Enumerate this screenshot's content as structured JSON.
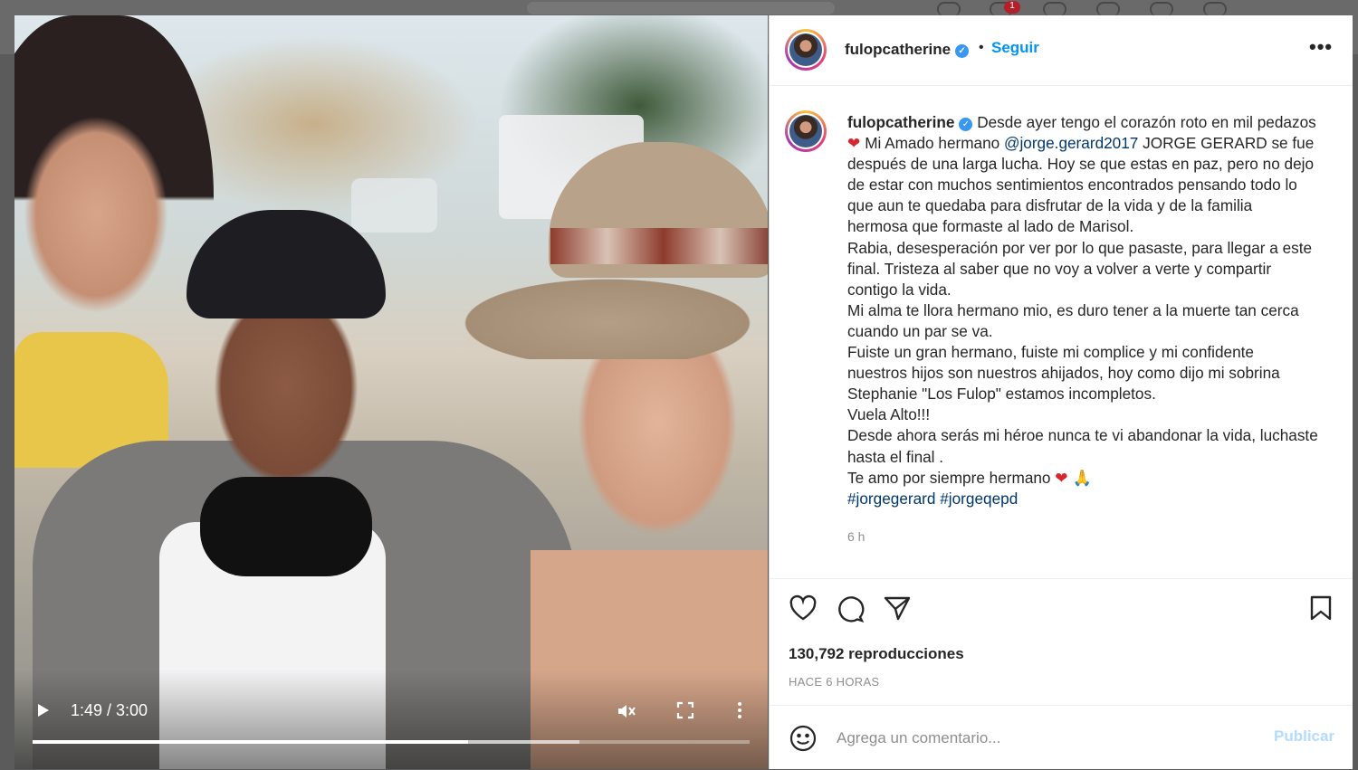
{
  "post": {
    "username": "fulopcatherine",
    "verified": true,
    "follow_label": "Seguir",
    "more_label": "•••",
    "caption_lines": [
      "Desde ayer tengo el corazón roto en mil pedazos",
      "Mi Amado hermano",
      "@jorge.gerard2017",
      "JORGE GERARD se fue",
      "después de una larga lucha. Hoy se que estas en paz, pero no dejo",
      "de estar con muchos sentimientos encontrados pensando todo lo",
      "que aun te quedaba para disfrutar de la vida y de la familia",
      "hermosa que formaste al lado de Marisol.",
      "Rabia, desesperación por ver por lo que pasaste, para llegar a este",
      "final. Tristeza al saber que no voy a volver a verte y compartir",
      "contigo la vida.",
      "Mi alma te llora hermano mio, es duro tener a la muerte tan cerca",
      "cuando un par se va.",
      "Fuiste un gran hermano, fuiste mi complice y mi confidente",
      "nuestros hijos son nuestros ahijados, hoy como dijo mi sobrina",
      "Stephanie \"Los Fulop\" estamos incompletos.",
      "Vuela Alto!!!",
      "Desde ahora serás mi héroe nunca te vi abandonar la vida, luchaste",
      "hasta el final .",
      "Te amo por siempre hermano",
      "#jorgegerard",
      "#jorgeqepd"
    ],
    "caption_age": "6 h",
    "views": "130,792 reproducciones",
    "posted": "HACE 6 HORAS",
    "comment_placeholder": "Agrega un comentario...",
    "publish_label": "Publicar"
  },
  "video": {
    "time": "1:49 / 3:00",
    "progress": 0.607,
    "buffered": 0.763
  },
  "topbar": {
    "notification_count": "1"
  },
  "colors": {
    "link": "#00376b",
    "accent": "#0095f6",
    "heart": "#d6262e"
  }
}
